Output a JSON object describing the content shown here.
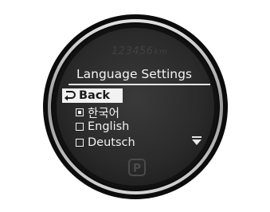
{
  "cluster": {
    "odometer_value": "123456",
    "odometer_unit": "km",
    "gear_indicator": "P",
    "icons": {
      "back": "return-arrow-icon",
      "scroll": "scroll-down-icon",
      "gear": "park-indicator-icon"
    }
  },
  "menu": {
    "title": "Language Settings",
    "back_label": "Back",
    "options": [
      {
        "label": "한국어",
        "checked": true
      },
      {
        "label": "English",
        "checked": false
      },
      {
        "label": "Deutsch",
        "checked": false
      }
    ]
  },
  "colors": {
    "ring_dark": "#0e0e0e",
    "ring_light": "#bfbfbf",
    "screen_bg": "#2b2b2b",
    "text": "#f2f2f2",
    "highlight_bg": "#f2f2f2"
  }
}
